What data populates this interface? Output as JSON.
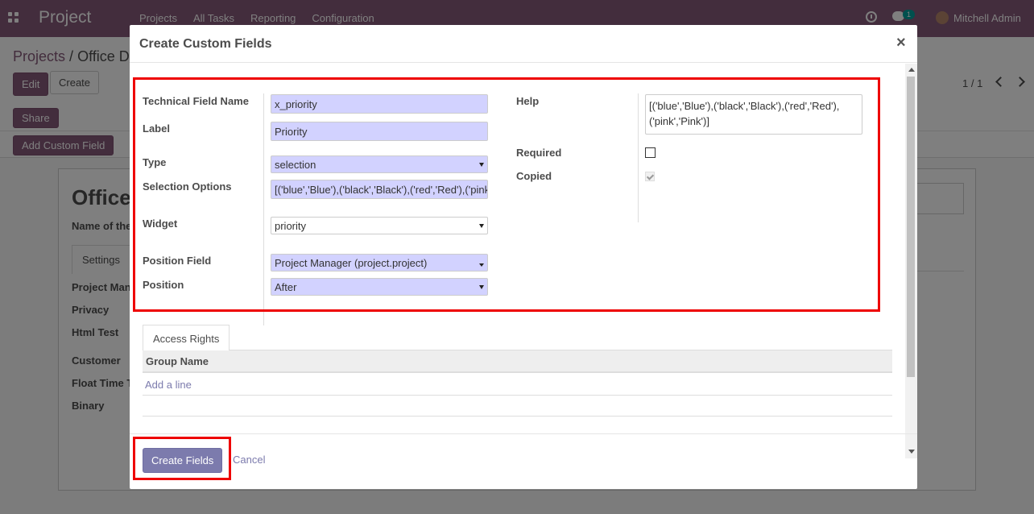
{
  "navbar": {
    "app_title": "Project",
    "menu": [
      "Projects",
      "All Tasks",
      "Reporting",
      "Configuration"
    ],
    "message_count": "1",
    "user_name": "Mitchell Admin"
  },
  "background": {
    "breadcrumb_root": "Projects",
    "breadcrumb_sep": "/",
    "breadcrumb_current": "Office D",
    "edit_label": "Edit",
    "create_label": "Create",
    "pager": "1 / 1",
    "share_label": "Share",
    "add_custom_field_label": "Add Custom Field",
    "record_title": "Office",
    "record_sub": "Name of the",
    "tab_settings": "Settings",
    "fields": [
      "Project Man",
      "Privacy",
      "Html Test",
      "Customer",
      "Float Time T",
      "Binary"
    ]
  },
  "modal": {
    "title": "Create Custom Fields",
    "close": "×",
    "labels": {
      "technical_name": "Technical Field Name",
      "label": "Label",
      "type": "Type",
      "selection_options": "Selection Options",
      "widget": "Widget",
      "position_field": "Position Field",
      "position": "Position",
      "help": "Help",
      "required": "Required",
      "copied": "Copied"
    },
    "values": {
      "technical_name": "x_priority",
      "label": "Priority",
      "type": "selection",
      "selection_options": "[('blue','Blue'),('black','Black'),('red','Red'),('pink','Pink')]",
      "widget": "priority",
      "position_field": "Project Manager (project.project)",
      "position": "After",
      "help": "[('blue','Blue'),('black','Black'),('red','Red'),('pink','Pink')]"
    },
    "required_checked": false,
    "copied_checked": true,
    "tab_access_rights": "Access Rights",
    "table_header_group": "Group Name",
    "add_line": "Add a line",
    "create_button": "Create Fields",
    "cancel_button": "Cancel"
  }
}
